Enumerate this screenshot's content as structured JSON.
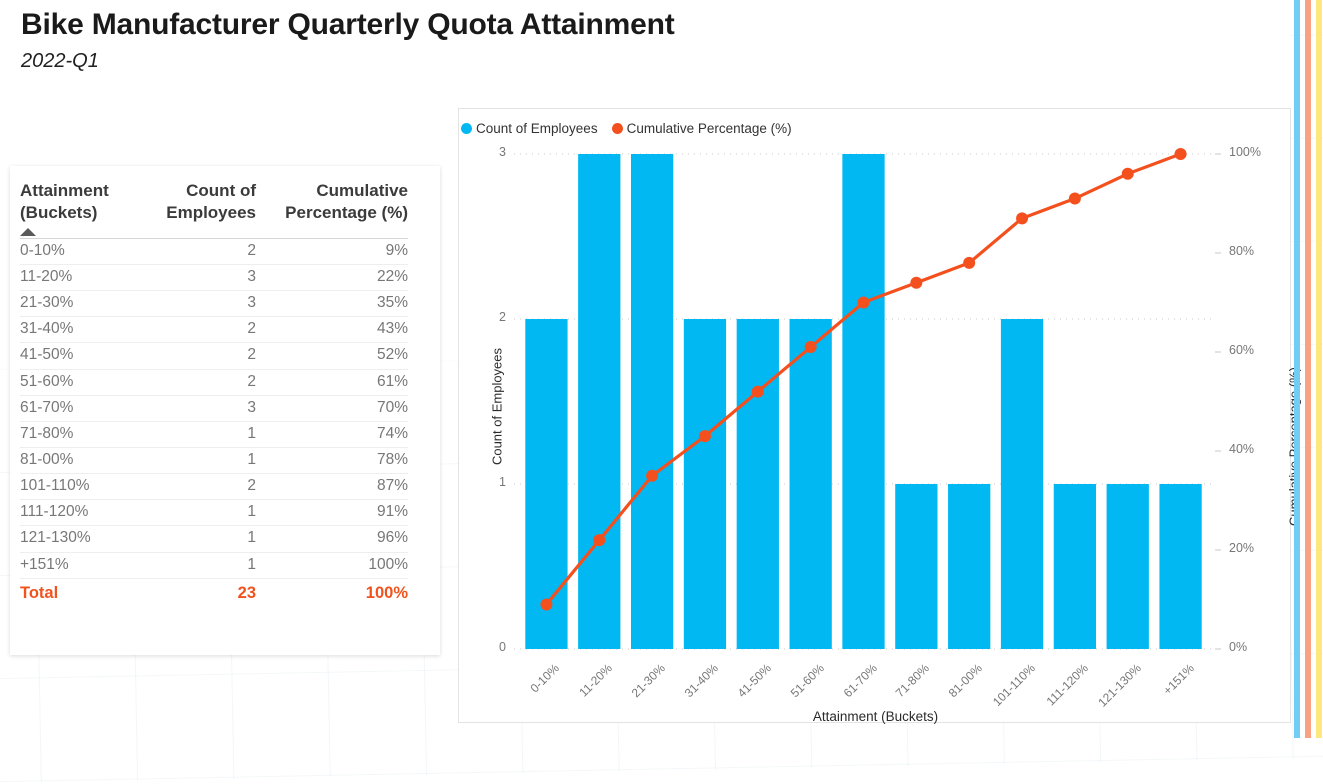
{
  "header": {
    "title": "Bike Manufacturer Quarterly Quota Attainment",
    "subtitle": "2022-Q1"
  },
  "table": {
    "columns": [
      "Attainment (Buckets)",
      "Count of Employees",
      "Cumulative Percentage (%)"
    ],
    "sort_indicator": "sort-ascending",
    "rows": [
      {
        "bucket": "0-10%",
        "count": "2",
        "cumulative": "9%"
      },
      {
        "bucket": "11-20%",
        "count": "3",
        "cumulative": "22%"
      },
      {
        "bucket": "21-30%",
        "count": "3",
        "cumulative": "35%"
      },
      {
        "bucket": "31-40%",
        "count": "2",
        "cumulative": "43%"
      },
      {
        "bucket": "41-50%",
        "count": "2",
        "cumulative": "52%"
      },
      {
        "bucket": "51-60%",
        "count": "2",
        "cumulative": "61%"
      },
      {
        "bucket": "61-70%",
        "count": "3",
        "cumulative": "70%"
      },
      {
        "bucket": "71-80%",
        "count": "1",
        "cumulative": "74%"
      },
      {
        "bucket": "81-00%",
        "count": "1",
        "cumulative": "78%"
      },
      {
        "bucket": "101-110%",
        "count": "2",
        "cumulative": "87%"
      },
      {
        "bucket": "111-120%",
        "count": "1",
        "cumulative": "91%"
      },
      {
        "bucket": "121-130%",
        "count": "1",
        "cumulative": "96%"
      },
      {
        "bucket": "+151%",
        "count": "1",
        "cumulative": "100%"
      }
    ],
    "total": {
      "label": "Total",
      "count": "23",
      "cumulative": "100%"
    }
  },
  "colors": {
    "bar": "#01b8f3",
    "line": "#f4501e",
    "total_text": "#f1531d",
    "stripe_blue": "#72cdf4",
    "stripe_salmon": "#f8a183",
    "stripe_yellow": "#fde77f"
  },
  "chart_data": {
    "type": "bar",
    "title": "",
    "xlabel": "Attainment (Buckets)",
    "ylabel": "Count of Employees",
    "y2label": "Cumulative Percentage (%)",
    "grid": true,
    "legend_position": "top-left",
    "categories": [
      "0-10%",
      "11-20%",
      "21-30%",
      "31-40%",
      "41-50%",
      "51-60%",
      "61-70%",
      "71-80%",
      "81-00%",
      "101-110%",
      "111-120%",
      "121-130%",
      "+151%"
    ],
    "series": [
      {
        "name": "Count of Employees",
        "type": "bar",
        "axis": "left",
        "color": "#01b8f3",
        "values": [
          2,
          3,
          3,
          2,
          2,
          2,
          3,
          1,
          1,
          2,
          1,
          1,
          1
        ]
      },
      {
        "name": "Cumulative Percentage (%)",
        "type": "line",
        "axis": "right",
        "color": "#f4501e",
        "values": [
          9,
          22,
          35,
          43,
          52,
          61,
          70,
          74,
          78,
          87,
          91,
          96,
          100
        ]
      }
    ],
    "ylim": [
      0,
      3
    ],
    "yticks": [
      "0",
      "1",
      "2",
      "3"
    ],
    "y2lim": [
      0,
      100
    ],
    "y2ticks": [
      "0%",
      "20%",
      "40%",
      "60%",
      "80%",
      "100%"
    ]
  }
}
